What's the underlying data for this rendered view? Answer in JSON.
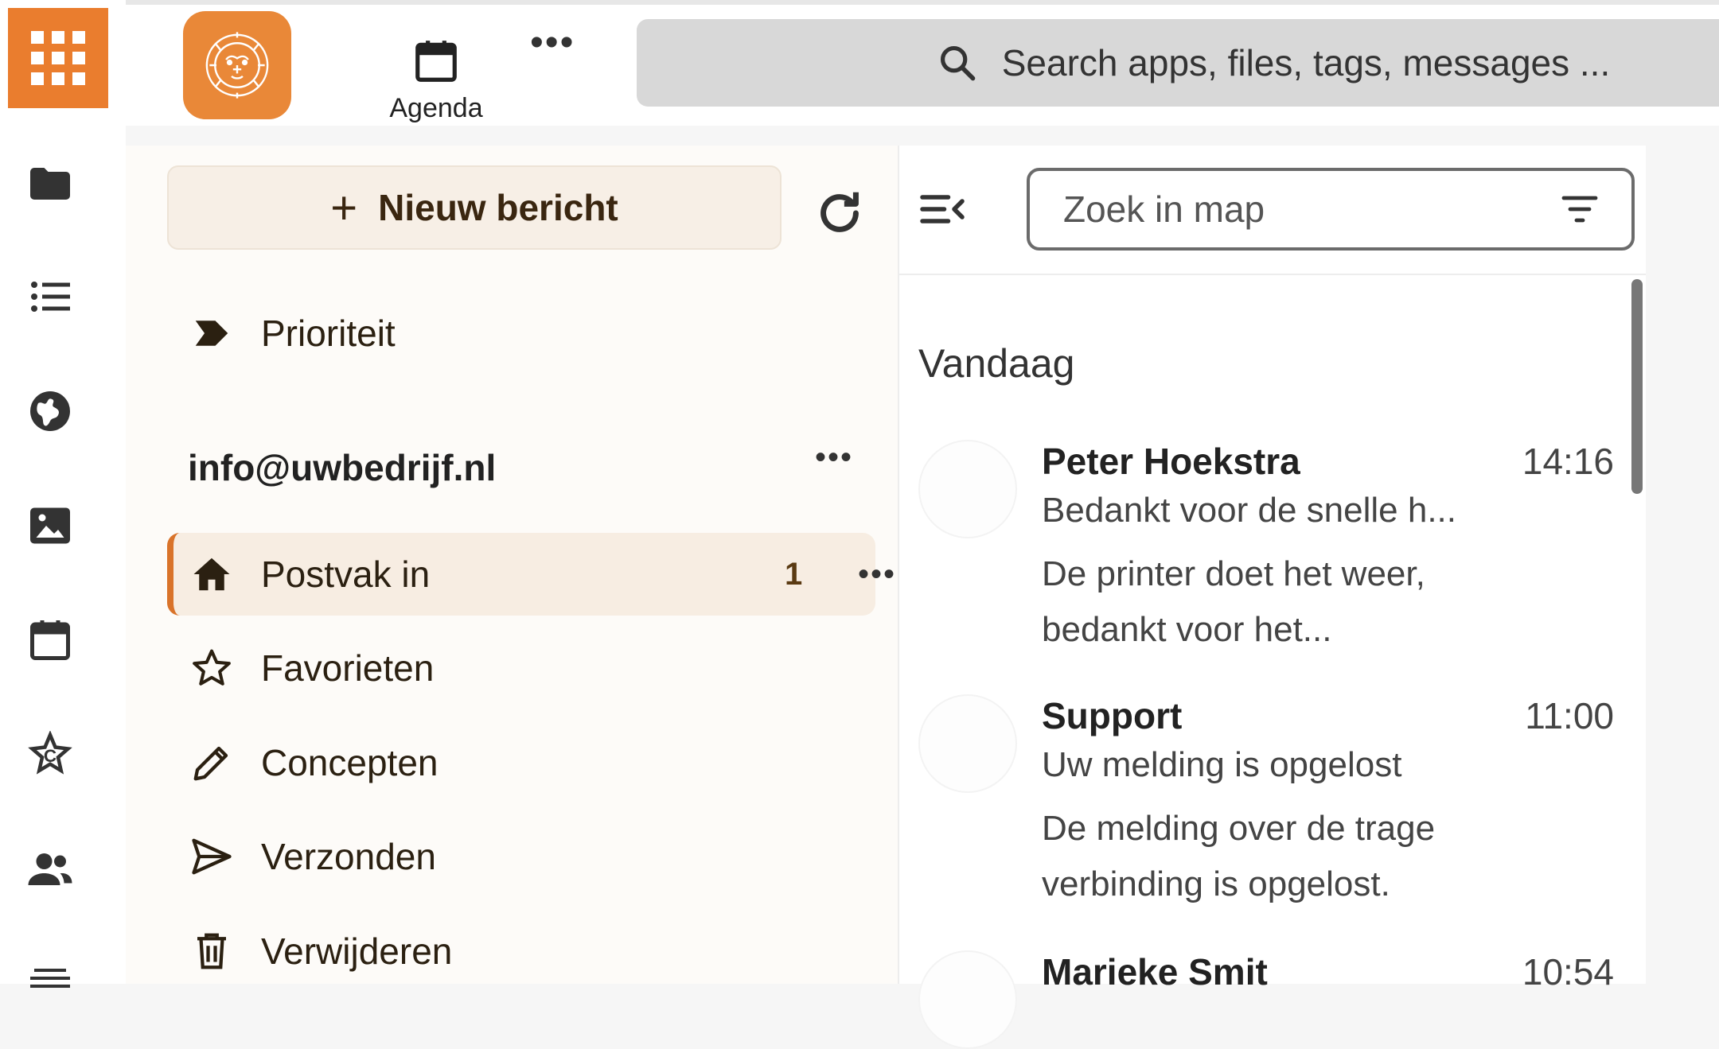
{
  "topbar": {
    "agenda_label": "Agenda",
    "more_label": "•••",
    "search_placeholder": "Search apps, files, tags, messages ..."
  },
  "rail": {
    "items": [
      "folder-icon",
      "list-icon",
      "globe-icon",
      "image-icon",
      "calendar-icon",
      "star-c-icon",
      "contacts-icon",
      "menu-icon"
    ]
  },
  "nav": {
    "new_message": "Nieuw bericht",
    "new_message_plus": "+",
    "priority": "Prioriteit",
    "account": "info@uwbedrijf.nl",
    "account_more": "•••",
    "folders": [
      {
        "label": "Postvak in",
        "count": "1",
        "more": "•••"
      },
      {
        "label": "Favorieten"
      },
      {
        "label": "Concepten"
      },
      {
        "label": "Verzonden"
      },
      {
        "label": "Verwijderen"
      }
    ]
  },
  "list": {
    "filter_placeholder": "Zoek in map",
    "day_label": "Vandaag",
    "messages": [
      {
        "sender": "Peter Hoekstra",
        "time": "14:16",
        "subject": "Bedankt voor de snelle h...",
        "preview": "De printer doet het weer, bedankt voor het..."
      },
      {
        "sender": "Support",
        "time": "11:00",
        "subject": "Uw melding is opgelost",
        "preview": "De melding over de trage verbinding is opgelost."
      },
      {
        "sender": "Marieke Smit",
        "time": "10:54",
        "subject": "",
        "preview": ""
      }
    ]
  },
  "colors": {
    "accent": "#ea7d2e",
    "logo": "#e98838",
    "selected_row": "#f7ede2",
    "new_button": "#f7efe6"
  }
}
